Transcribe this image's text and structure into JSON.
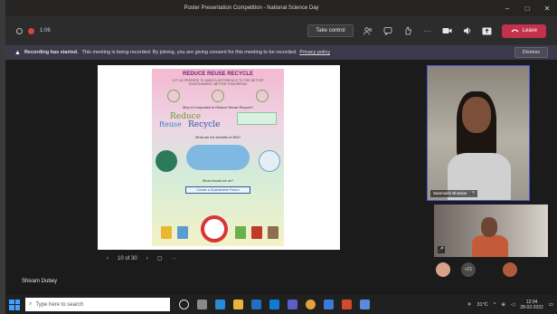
{
  "window": {
    "title": "Poster Presentation Competition - National Science Day",
    "minimize": "–",
    "maximize": "□",
    "close": "✕"
  },
  "toolbar": {
    "timer": "1:06",
    "take_control": "Take control",
    "leave_label": "Leave",
    "icons": [
      "people-icon",
      "chat-icon",
      "reactions-icon",
      "more-icon",
      "camera-icon",
      "mic-icon",
      "share-icon"
    ]
  },
  "banner": {
    "title": "Recording has started.",
    "message": "This meeting is being recorded. By joining, you are giving consent for this meeting to be recorded.",
    "link": "Privacy policy",
    "dismiss": "Dismiss"
  },
  "poster": {
    "title": "REDUCE REUSE RECYCLE",
    "subtitle": "LET US PREPARE TO MAKE A DIFFERENCE TO THE BETTER ENVIRONMENT, BETTER TOMORROW",
    "question1": "Why is it important to Reduce Reuse Recycle?",
    "word_reduce": "Reduce",
    "word_reuse": "Reuse",
    "word_recycle": "Recycle",
    "question2": "What are the benefits of 3Rs?",
    "question3": "What should we do?",
    "cta": "Create a Sustainable Future"
  },
  "pager": {
    "prev": "‹",
    "page": "10 of 30",
    "next": "›"
  },
  "presenter": "Shivam Dubey",
  "participants": {
    "main_name": "Sanmukhi Bhasker",
    "second_mic": "🎤",
    "avatar_count": "+21"
  },
  "taskbar": {
    "search_placeholder": "Type here to search",
    "weather": "31°C",
    "time": "12:04",
    "date": "28-02-2022"
  }
}
